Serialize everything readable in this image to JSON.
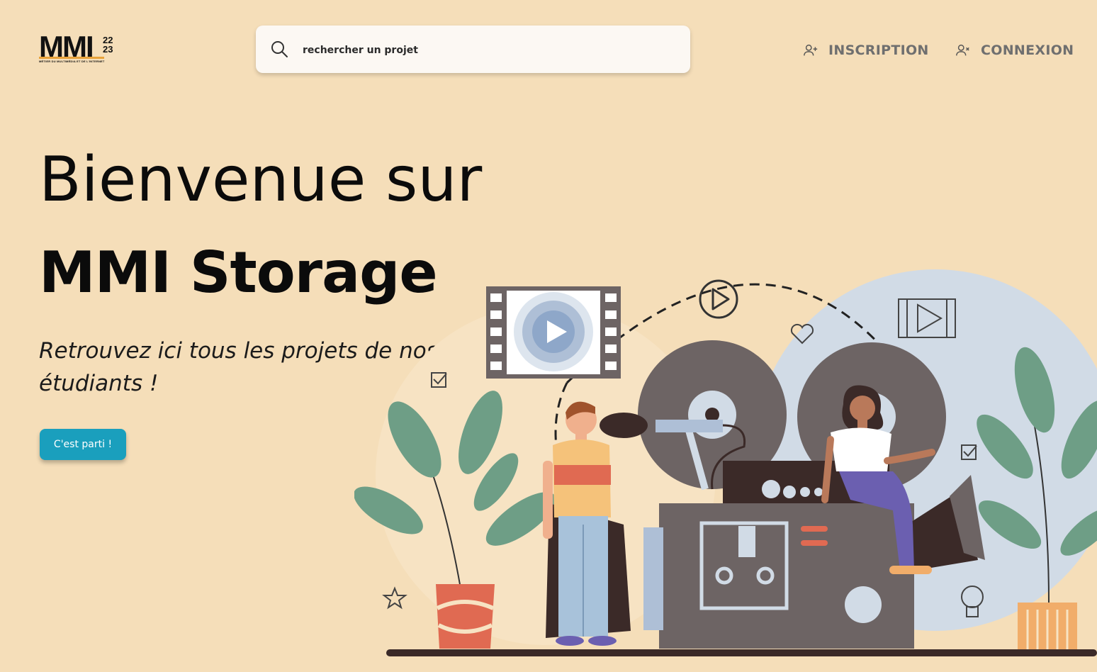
{
  "logo": {
    "main": "MMI",
    "years_top": "22",
    "years_bottom": "23",
    "tagline": "MÉTIER DU MULTIMÉDIA ET DE L'INTERNET"
  },
  "search": {
    "placeholder": "rechercher un projet",
    "value": ""
  },
  "nav": {
    "inscription": "INSCRIPTION",
    "connexion": "CONNEXION"
  },
  "hero": {
    "line1": "Bienvenue sur",
    "line2": "MMI Storage",
    "subtitle": "Retrouvez ici tous les projets de nos étudiants !",
    "cta": "C'est parti !"
  },
  "colors": {
    "background": "#f5deb9",
    "accent": "#1a9fbd",
    "nav_text": "#6f6f6f",
    "plant_leaf": "#6e9e86",
    "pot": "#e06a52",
    "camera": "#6d6464",
    "blob": "#d1dbe6"
  },
  "icons": [
    "search-icon",
    "add-user-icon",
    "user-x-icon",
    "play-icon",
    "heart-icon",
    "star-icon",
    "checkbox-icon",
    "lightbulb-icon",
    "film-strip-icon"
  ]
}
